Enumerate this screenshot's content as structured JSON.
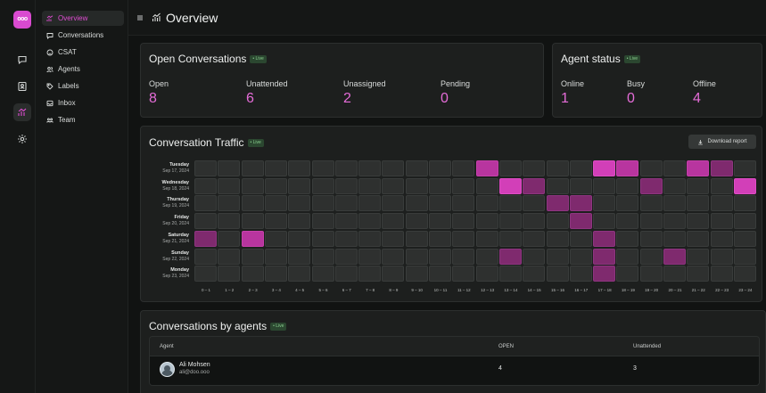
{
  "app": {
    "logo_text": "ooo",
    "accent": "#e04dd3"
  },
  "rail": {
    "items": [
      {
        "icon": "chat-icon"
      },
      {
        "icon": "contacts-icon"
      },
      {
        "icon": "reports-icon",
        "active": true
      },
      {
        "icon": "gear-icon"
      }
    ]
  },
  "subnav": {
    "items": [
      {
        "label": "Overview",
        "icon": "chart-icon",
        "active": true
      },
      {
        "label": "Conversations",
        "icon": "chat-icon"
      },
      {
        "label": "CSAT",
        "icon": "smile-icon"
      },
      {
        "label": "Agents",
        "icon": "users-icon"
      },
      {
        "label": "Labels",
        "icon": "tag-icon"
      },
      {
        "label": "Inbox",
        "icon": "inbox-icon"
      },
      {
        "label": "Team",
        "icon": "team-icon"
      }
    ]
  },
  "header": {
    "title": "Overview"
  },
  "open_conversations": {
    "title": "Open Conversations",
    "live": "• Live",
    "metrics": [
      {
        "label": "Open",
        "value": "8"
      },
      {
        "label": "Unattended",
        "value": "6"
      },
      {
        "label": "Unassigned",
        "value": "2"
      },
      {
        "label": "Pending",
        "value": "0"
      }
    ]
  },
  "agent_status": {
    "title": "Agent status",
    "live": "• Live",
    "metrics": [
      {
        "label": "Online",
        "value": "1"
      },
      {
        "label": "Busy",
        "value": "0"
      },
      {
        "label": "Offline",
        "value": "4"
      }
    ]
  },
  "traffic": {
    "title": "Conversation Traffic",
    "live": "• Live",
    "download_label": "Download report",
    "rows": [
      {
        "day": "Tuesday",
        "date": "Sep 17, 2024"
      },
      {
        "day": "Wednesday",
        "date": "Sep 18, 2024"
      },
      {
        "day": "Thursday",
        "date": "Sep 19, 2024"
      },
      {
        "day": "Friday",
        "date": "Sep 20, 2024"
      },
      {
        "day": "Saturday",
        "date": "Sep 21, 2024"
      },
      {
        "day": "Sunday",
        "date": "Sep 22, 2024"
      },
      {
        "day": "Monday",
        "date": "Sep 23, 2024"
      }
    ],
    "hours": [
      "0 – 1",
      "1 – 2",
      "2 – 3",
      "3 – 4",
      "4 – 5",
      "5 – 6",
      "6 – 7",
      "7 – 8",
      "8 – 9",
      "9 – 10",
      "10 – 11",
      "11 – 12",
      "12 – 13",
      "13 – 14",
      "14 – 15",
      "15 – 16",
      "16 – 17",
      "17 – 18",
      "18 – 19",
      "19 – 20",
      "20 – 21",
      "21 – 22",
      "22 – 23",
      "23 – 24"
    ],
    "intensity": [
      [
        0,
        0,
        0,
        0,
        0,
        0,
        0,
        0,
        0,
        0,
        0,
        0,
        2,
        0,
        0,
        0,
        0,
        3,
        2,
        0,
        0,
        2,
        1,
        0
      ],
      [
        0,
        0,
        0,
        0,
        0,
        0,
        0,
        0,
        0,
        0,
        0,
        0,
        0,
        3,
        1,
        0,
        0,
        0,
        0,
        1,
        0,
        0,
        0,
        3
      ],
      [
        0,
        0,
        0,
        0,
        0,
        0,
        0,
        0,
        0,
        0,
        0,
        0,
        0,
        0,
        0,
        1,
        1,
        0,
        0,
        0,
        0,
        0,
        0,
        0
      ],
      [
        0,
        0,
        0,
        0,
        0,
        0,
        0,
        0,
        0,
        0,
        0,
        0,
        0,
        0,
        0,
        0,
        1,
        0,
        0,
        0,
        0,
        0,
        0,
        0
      ],
      [
        1,
        0,
        2,
        0,
        0,
        0,
        0,
        0,
        0,
        0,
        0,
        0,
        0,
        0,
        0,
        0,
        0,
        1,
        0,
        0,
        0,
        0,
        0,
        0
      ],
      [
        0,
        0,
        0,
        0,
        0,
        0,
        0,
        0,
        0,
        0,
        0,
        0,
        0,
        1,
        0,
        0,
        0,
        1,
        0,
        0,
        1,
        0,
        0,
        0
      ],
      [
        0,
        0,
        0,
        0,
        0,
        0,
        0,
        0,
        0,
        0,
        0,
        0,
        0,
        0,
        0,
        0,
        0,
        1,
        0,
        0,
        0,
        0,
        0,
        0
      ]
    ]
  },
  "agents_table": {
    "title": "Conversations by agents",
    "live": "• Live",
    "columns": {
      "agent": "Agent",
      "open": "OPEN",
      "unattended": "Unattended"
    },
    "rows": [
      {
        "name": "Ali Mohsen",
        "email": "ali@doo.ooo",
        "open": "4",
        "unattended": "3"
      }
    ]
  }
}
